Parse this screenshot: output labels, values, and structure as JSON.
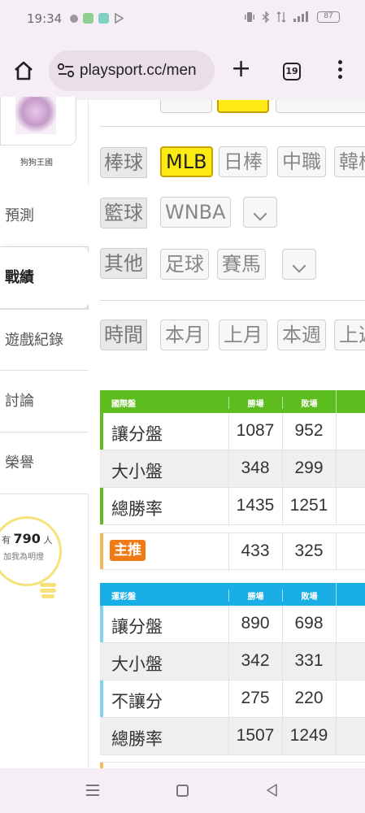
{
  "status_bar": {
    "time": "19:34",
    "battery": "87",
    "icons": [
      "notification-dot-icon",
      "app-icon-green",
      "app-icon-teal",
      "play-icon",
      "vibrate-icon",
      "bluetooth-icon",
      "signal-icon"
    ]
  },
  "browser": {
    "url": "playsport.cc/men",
    "tab_count": "19",
    "accent": "#f6eef6"
  },
  "sidebar": {
    "user_name": "狗狗王國",
    "items": [
      {
        "label": "預測",
        "active": false
      },
      {
        "label": "戰績",
        "active": true
      },
      {
        "label": "遊戲紀錄",
        "active": false
      },
      {
        "label": "討論",
        "active": false
      },
      {
        "label": "榮譽",
        "active": false
      }
    ],
    "bulb": {
      "prefix": "有",
      "count": "790",
      "suffix": "人",
      "caption": "加我為明燈"
    }
  },
  "filters": {
    "baseball": {
      "category": "棒球",
      "options": [
        "MLB",
        "日棒",
        "中職",
        "韓棒"
      ],
      "selected": "MLB"
    },
    "basketball": {
      "category": "籃球",
      "options": [
        "WNBA"
      ]
    },
    "other": {
      "category": "其他",
      "options": [
        "足球",
        "賽馬"
      ]
    },
    "time": {
      "category": "時間",
      "options": [
        "本月",
        "上月",
        "本週",
        "上週"
      ]
    }
  },
  "international_table": {
    "header_label": "國際盤",
    "col_win": "勝場",
    "col_loss": "敗場",
    "header_color": "#5ebd1e",
    "rows": [
      {
        "label": "讓分盤",
        "win": "1087",
        "loss": "952"
      },
      {
        "label": "大小盤",
        "win": "348",
        "loss": "299"
      },
      {
        "label": "總勝率",
        "win": "1435",
        "loss": "1251"
      }
    ],
    "main_pick": {
      "label": "主推",
      "win": "433",
      "loss": "325"
    }
  },
  "lottery_table": {
    "header_label": "運彩盤",
    "col_win": "勝場",
    "col_loss": "敗場",
    "header_color": "#19aee6",
    "rows": [
      {
        "label": "讓分盤",
        "win": "890",
        "loss": "698"
      },
      {
        "label": "大小盤",
        "win": "342",
        "loss": "331"
      },
      {
        "label": "不讓分",
        "win": "275",
        "loss": "220"
      },
      {
        "label": "總勝率",
        "win": "1507",
        "loss": "1249"
      }
    ]
  }
}
